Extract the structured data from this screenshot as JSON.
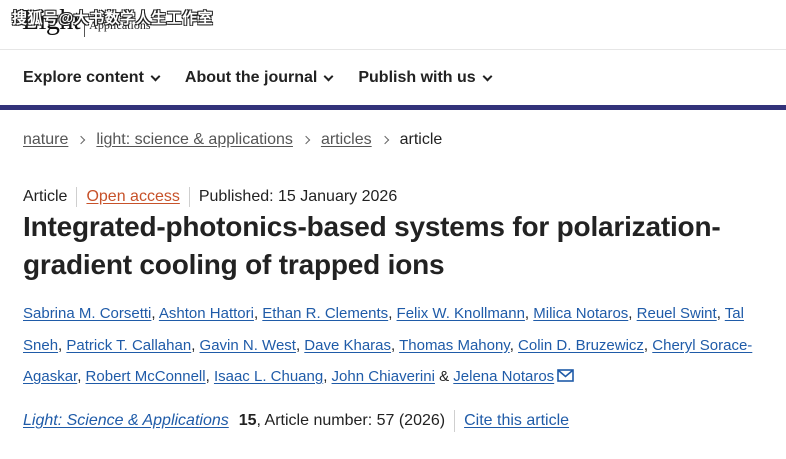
{
  "header": {
    "logo_main": "Light",
    "logo_sub": "Applications",
    "watermark": "搜狐号@大书数学人生工作室"
  },
  "nav": {
    "items": [
      {
        "label": "Explore content"
      },
      {
        "label": "About the journal"
      },
      {
        "label": "Publish with us"
      }
    ]
  },
  "breadcrumb": {
    "items": [
      "nature",
      "light: science & applications",
      "articles"
    ],
    "current": "article"
  },
  "article": {
    "type": "Article",
    "access": "Open access",
    "published": "Published: 15 January 2026",
    "title": "Integrated-photonics-based systems for polarization-gradient cooling of trapped ions",
    "authors": [
      "Sabrina M. Corsetti",
      "Ashton Hattori",
      "Ethan R. Clements",
      "Felix W. Knollmann",
      "Milica Notaros",
      "Reuel Swint",
      "Tal Sneh",
      "Patrick T. Callahan",
      "Gavin N. West",
      "Dave Kharas",
      "Thomas Mahony",
      "Colin D. Bruzewicz",
      "Cheryl Sorace-Agaskar",
      "Robert McConnell",
      "Isaac L. Chuang",
      "John Chiaverini",
      "Jelena Notaros"
    ],
    "author_sep": ", ",
    "author_last_sep": " & ",
    "journal": "Light: Science & Applications",
    "volume": "15",
    "article_number": ", Article number: 57 (2026)",
    "cite_label": "Cite this article"
  },
  "icons": {
    "nav_chevron": "chevron-down-icon",
    "breadcrumb_chevron": "chevron-right-icon",
    "author_email": "mail-icon"
  },
  "colors": {
    "nav_rule": "#32327a",
    "link": "#1f5ba8",
    "open_access": "#c7522a"
  }
}
